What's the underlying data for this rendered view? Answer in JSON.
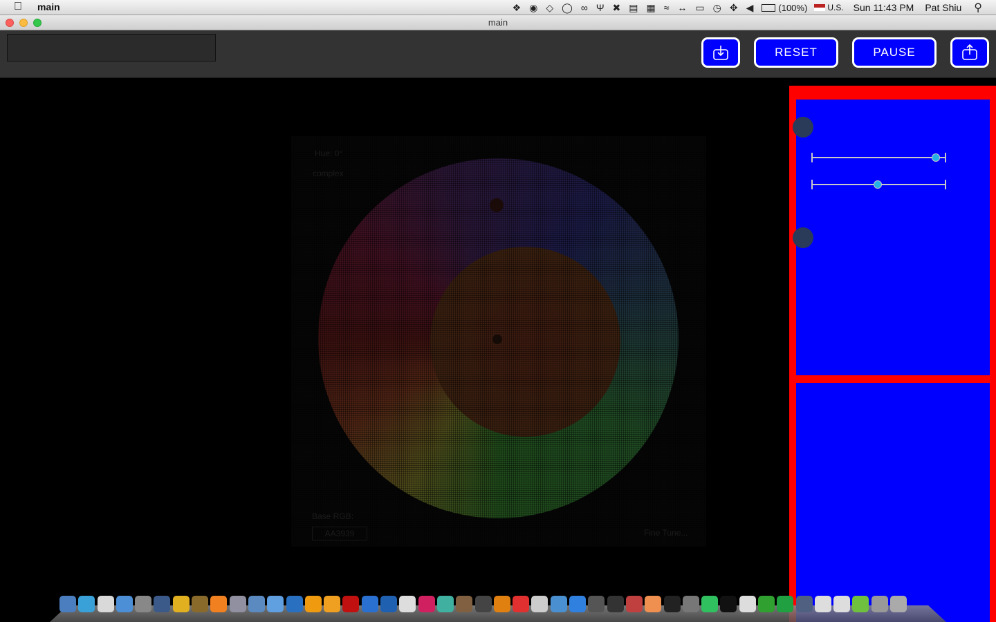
{
  "menubar": {
    "app_name": "main",
    "battery": "(100%)",
    "input_source": "U.S.",
    "clock": "Sun 11:43 PM",
    "user": "Pat Shiu"
  },
  "window": {
    "title": "main"
  },
  "toolbar": {
    "search_value": "",
    "reset_label": "RESET",
    "pause_label": "PAUSE"
  },
  "wheel": {
    "hue_label": "Hue: 0°",
    "mode_label": "complex",
    "base_rgb_label": "Base RGB:",
    "hex_value": "AA3939",
    "fine_tune_label": "Fine Tune..."
  },
  "sliders": [
    {
      "name": "slider-1",
      "value_fraction": 0.95
    },
    {
      "name": "slider-2",
      "value_fraction": 0.49
    }
  ],
  "colors": {
    "accent_blue": "#0000ff",
    "panel_red": "#ff0000",
    "slider_thumb": "#23b1e6"
  },
  "dock": {
    "icons": [
      "finder-icon",
      "app-store-icon",
      "calendar-icon",
      "itunes-icon",
      "utility-icon",
      "network-icon",
      "chrome-canary-icon",
      "globe-icon",
      "vlc-icon",
      "pen-icon",
      "charts-icon",
      "network-app-icon",
      "safari-like-icon",
      "illustrator-icon",
      "illustrator-icon-2",
      "flash-icon",
      "photoshop-icon",
      "photoshop-icon-2",
      "sketch-icon",
      "lips-icon",
      "pinwheel-icon",
      "character-icon",
      "disk-icon",
      "sublime-icon",
      "acrobat-icon",
      "preview-icon",
      "wifi-app-icon",
      "chrome-icon",
      "wordpress-icon",
      "font-icon",
      "rocket-icon",
      "chat-icon",
      "camera-icon",
      "printer-icon",
      "swatches-icon",
      "terminal-icon",
      "notes-icon",
      "evernote-icon",
      "spotify-icon",
      "steam-icon",
      "java-icon",
      "java-icon-2",
      "numbers-icon",
      "folder-icon",
      "trash-icon"
    ]
  }
}
